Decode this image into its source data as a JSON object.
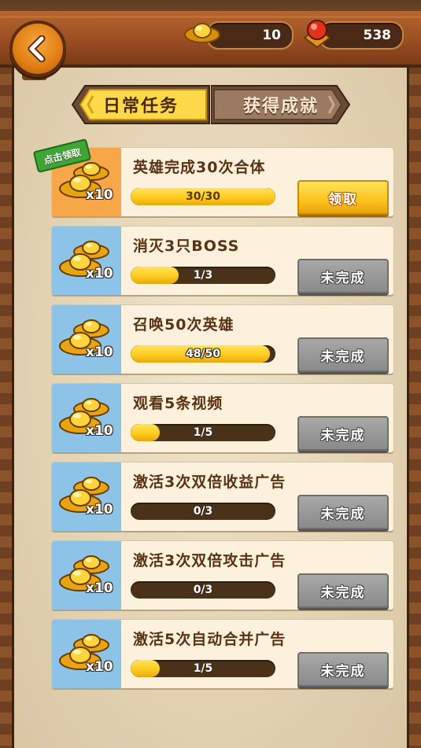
{
  "header": {
    "gold_count": "10",
    "gem_count": "538",
    "back_icon": "back-arrow-icon",
    "gold_icon": "gold-ingot-icon",
    "gem_icon": "gem-icon"
  },
  "tabs": [
    {
      "label": "日常任务",
      "active": true
    },
    {
      "label": "获得成就",
      "active": false
    }
  ],
  "colors": {
    "reward_panel_blue": "#8ec3e8",
    "reward_panel_orange": "#f7a748",
    "claim_button": "#fcc21e",
    "pending_button": "#8a8a8a",
    "progress_fill": "#ffcb1f"
  },
  "tasks": [
    {
      "title": "英雄完成30次合体",
      "reward": "x10",
      "progress_text": "30/30",
      "progress": 1.0,
      "button": "领取",
      "state": "ready",
      "tag": "点击领取"
    },
    {
      "title": "消灭3只BOSS",
      "reward": "x10",
      "progress_text": "1/3",
      "progress": 0.333,
      "button": "未完成",
      "state": "pending"
    },
    {
      "title": "召唤50次英雄",
      "reward": "x10",
      "progress_text": "48/50",
      "progress": 0.96,
      "button": "未完成",
      "state": "pending"
    },
    {
      "title": "观看5条视频",
      "reward": "x10",
      "progress_text": "1/5",
      "progress": 0.2,
      "button": "未完成",
      "state": "pending"
    },
    {
      "title": "激活3次双倍收益广告",
      "reward": "x10",
      "progress_text": "0/3",
      "progress": 0.0,
      "button": "未完成",
      "state": "pending"
    },
    {
      "title": "激活3次双倍攻击广告",
      "reward": "x10",
      "progress_text": "0/3",
      "progress": 0.0,
      "button": "未完成",
      "state": "pending"
    },
    {
      "title": "激活5次自动合并广告",
      "reward": "x10",
      "progress_text": "1/5",
      "progress": 0.2,
      "button": "未完成",
      "state": "pending"
    }
  ]
}
